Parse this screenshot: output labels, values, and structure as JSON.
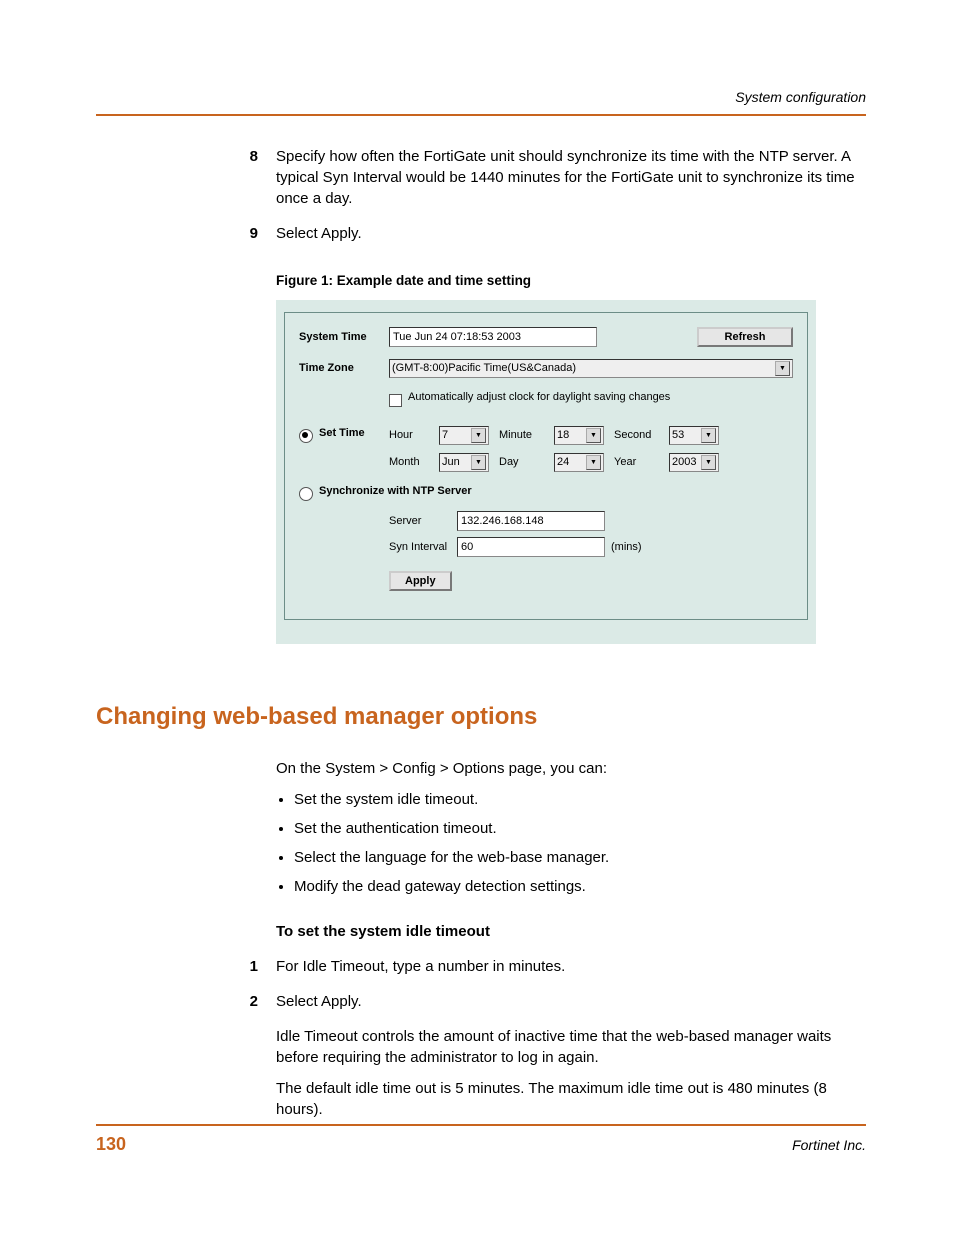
{
  "header": {
    "running": "System configuration"
  },
  "steps": {
    "s8num": "8",
    "s8text": "Specify how often the FortiGate unit should synchronize its time with the NTP server. A typical Syn Interval would be 1440 minutes for the FortiGate unit to synchronize its time once a day.",
    "s9num": "9",
    "s9text": "Select Apply."
  },
  "figure": {
    "caption": "Figure 1:   Example date and time setting"
  },
  "ss": {
    "systime_label": "System Time",
    "systime_value": "Tue Jun 24 07:18:53 2003",
    "refresh": "Refresh",
    "tz_label": "Time Zone",
    "tz_value": "(GMT-8:00)Pacific Time(US&Canada)",
    "dst_label": "Automatically adjust clock for daylight saving changes",
    "settime_label": "Set Time",
    "hour_label": "Hour",
    "hour_value": "7",
    "minute_label": "Minute",
    "minute_value": "18",
    "second_label": "Second",
    "second_value": "53",
    "month_label": "Month",
    "month_value": "Jun",
    "day_label": "Day",
    "day_value": "24",
    "year_label": "Year",
    "year_value": "2003",
    "ntp_label": "Synchronize with NTP Server",
    "server_label": "Server",
    "server_value": "132.246.168.148",
    "interval_label": "Syn Interval",
    "interval_value": "60",
    "interval_unit": "(mins)",
    "apply": "Apply"
  },
  "section": {
    "heading": "Changing web-based manager options",
    "intro": "On the System > Config > Options page, you can:",
    "b1": "Set the system idle timeout.",
    "b2": "Set the authentication timeout.",
    "b3": "Select the language for the web-base manager.",
    "b4": "Modify the dead gateway detection settings.",
    "subheading": "To set the system idle timeout",
    "n1num": "1",
    "n1text": "For Idle Timeout, type a number in minutes.",
    "n2num": "2",
    "n2text": "Select Apply.",
    "p1": "Idle Timeout controls the amount of inactive time that the web-based manager waits before requiring the administrator to log in again.",
    "p2": "The default idle time out is 5 minutes. The maximum idle time out is 480 minutes (8 hours)."
  },
  "footer": {
    "page": "130",
    "company": "Fortinet Inc."
  }
}
